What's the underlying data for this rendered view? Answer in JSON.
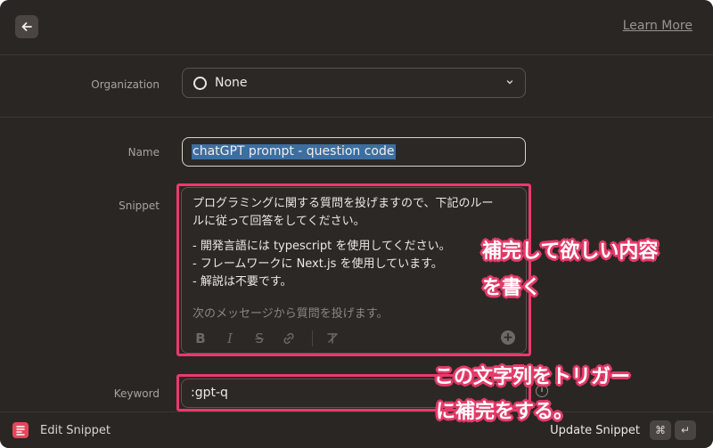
{
  "header": {
    "back_icon": "arrow-left-icon",
    "learn_more": "Learn More"
  },
  "form": {
    "organization": {
      "label": "Organization",
      "value": "None",
      "icon": "circle-icon",
      "chevron": "chevron-down-icon"
    },
    "name": {
      "label": "Name",
      "value": "chatGPT prompt - question code"
    },
    "snippet": {
      "label": "Snippet",
      "lines": [
        "プログラミングに関する質問を投げますので、下記のルー",
        "ルに従って回答をしてください。",
        "- 開発言語には typescript を使用してください。",
        "- フレームワークに Next.js を使用しています。",
        "- 解説は不要です。",
        "次のメッセージから質問を投げます。"
      ],
      "toolbar": [
        "bold-icon",
        "italic-icon",
        "strikethrough-icon",
        "link-icon",
        "clear-format-icon",
        "add-icon"
      ]
    },
    "keyword": {
      "label": "Keyword",
      "value": ":gpt-q",
      "info_icon": "info-icon"
    }
  },
  "footer": {
    "title": "Edit Snippet",
    "action": "Update Snippet",
    "keys": [
      "⌘",
      "↵"
    ]
  },
  "annotations": {
    "snippet_note_line1": "補完して欲しい内容",
    "snippet_note_line2": "を書く",
    "keyword_note_line1": "この文字列をトリガー",
    "keyword_note_line2": "に補完をする。"
  },
  "colors": {
    "window_bg": "#2a2624",
    "highlight": "#ea3a6d",
    "selection": "#3d6ea0"
  }
}
